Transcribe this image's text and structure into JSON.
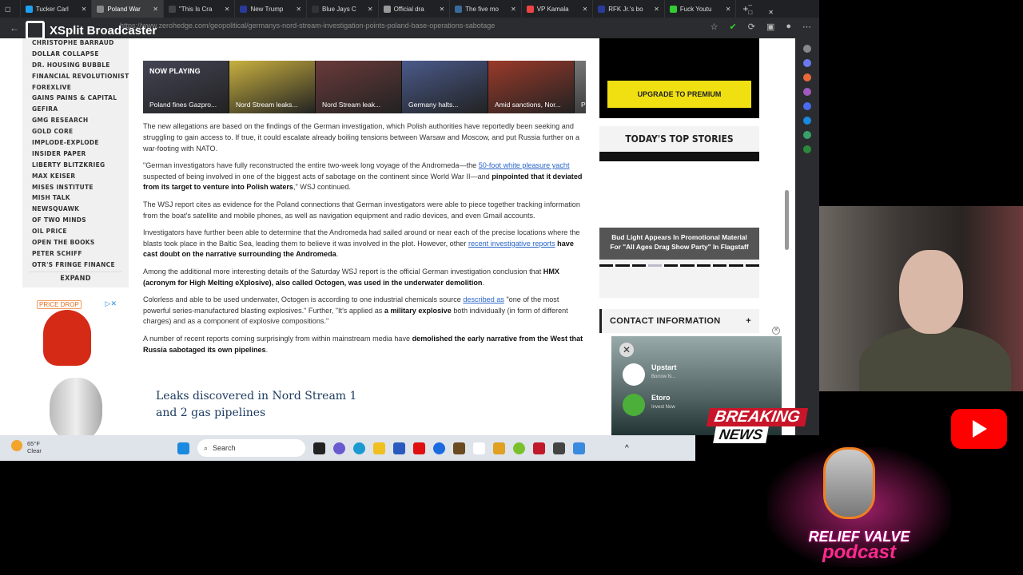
{
  "browser": {
    "tabs": [
      {
        "label": "Tucker Carl",
        "color": "#1da1f2"
      },
      {
        "label": "Poland War",
        "color": "#888",
        "active": true
      },
      {
        "label": "\"This Is Cra",
        "color": "#444"
      },
      {
        "label": "New Trump",
        "color": "#2a3a9a"
      },
      {
        "label": "Blue Jays C",
        "color": "#333"
      },
      {
        "label": "Official dra",
        "color": "#999"
      },
      {
        "label": "The five mo",
        "color": "#3a6a9a"
      },
      {
        "label": "VP Kamala",
        "color": "#e44"
      },
      {
        "label": "RFK Jr.'s bo",
        "color": "#2a3a9a"
      },
      {
        "label": "Fuck Youtu",
        "color": "#3c3"
      }
    ],
    "url": "https://www.zerohedge.com/geopolitical/germanys-nord-stream-investigation-points-poland-base-operations-sabotage",
    "overlay_title": "XSplit Broadcaster"
  },
  "sidebar": {
    "items": [
      "CHRISTOPHE BARRAUD",
      "DOLLAR COLLAPSE",
      "DR. HOUSING BUBBLE",
      "FINANCIAL REVOLUTIONIST",
      "FOREXLIVE",
      "GAINS PAINS & CAPITAL",
      "GEFIRA",
      "GMG RESEARCH",
      "GOLD CORE",
      "IMPLODE-EXPLODE",
      "INSIDER PAPER",
      "LIBERTY BLITZKRIEG",
      "MAX KEISER",
      "MISES INSTITUTE",
      "MISH TALK",
      "NEWSQUAWK",
      "OF TWO MINDS",
      "OIL PRICE",
      "OPEN THE BOOKS",
      "PETER SCHIFF",
      "OTR'S FRINGE FINANCE"
    ],
    "expand": "EXPAND"
  },
  "ad": {
    "badge": "PRICE DROP"
  },
  "video": {
    "now_playing": "NOW PLAYING",
    "items": [
      "Poland fines Gazpro...",
      "Nord Stream leaks...",
      "Nord Stream leak...",
      "Germany halts...",
      "Amid sanctions, Nor...",
      "Po"
    ]
  },
  "article": {
    "p1": "The new allegations are based on the findings of the German investigation, which Polish authorities have reportedly been seeking and struggling to gain access to. If true, it could escalate already boiling tensions between Warsaw and Moscow, and put Russia further on a war-footing with NATO.",
    "p2a": "\"German investigators have fully reconstructed the entire two-week long voyage of the Andromeda—the ",
    "p2link": "50-foot white pleasure yacht",
    "p2b": " suspected of being involved in one of the biggest acts of sabotage on the continent since World War II—and ",
    "p2bold": "pinpointed that it deviated from its target to venture into Polish waters",
    "p2c": ",\" WSJ continued.",
    "p3": "The WSJ report cites as evidence for the Poland connections that German investigators were able to piece together tracking information from the boat's satellite and mobile phones, as well as navigation equipment and radio devices, and even Gmail accounts.",
    "p4a": "Investigators have further been able to determine that the Andromeda had sailed around or near each of the precise locations where the blasts took place in the Baltic Sea, leading them to believe it was involved in the plot. However, other ",
    "p4link": "recent investigative reports",
    "p4bold": " have cast doubt on the narrative surrounding the Andromeda",
    "p5a": "Among the additional more interesting details of the Saturday WSJ report is the official German investigation conclusion that ",
    "p5bold": "HMX (acronym for High Melting eXplosive), also called Octogen, was used in the underwater demolition",
    "p6a": "Colorless and able to be used underwater, Octogen is according to one industrial chemicals source ",
    "p6link": "described as",
    "p6b": " \"one of the most powerful series-manufactured blasting explosives.\" Further, \"It's applied as ",
    "p6bold": "a military explosive",
    "p6c": " both individually (in form of different charges) and as a component of explosive compositions.\"",
    "p7a": "A number of recent reports coming surprisingly from within mainstream media have ",
    "p7bold": "demolished the early narrative from the West that Russia sabotaged its own pipelines",
    "figure_title": "Leaks discovered in Nord Stream 1 and 2 gas pipelines"
  },
  "right": {
    "upgrade": "UPGRADE TO PREMIUM",
    "top_stories": "TODAY'S TOP STORIES",
    "story_caption": "Bud Light Appears In Promotional Material For \"All Ages Drag Show Party\" In Flagstaff",
    "slide_index": 4,
    "slide_count": 10,
    "contact": "CONTACT INFORMATION",
    "contact_toggle": "+"
  },
  "popup": {
    "items": [
      {
        "name": "Upstart",
        "sub": "Borrow N..."
      },
      {
        "name": "Etoro",
        "sub": "Invest Now"
      }
    ]
  },
  "taskbar": {
    "temp": "65°F",
    "condition": "Clear",
    "search": "Search"
  },
  "stream": {
    "breaking": "BREAKING",
    "news": "NEWS",
    "podcast_line1": "RELIEF VALVE",
    "podcast_line2": "podcast"
  }
}
